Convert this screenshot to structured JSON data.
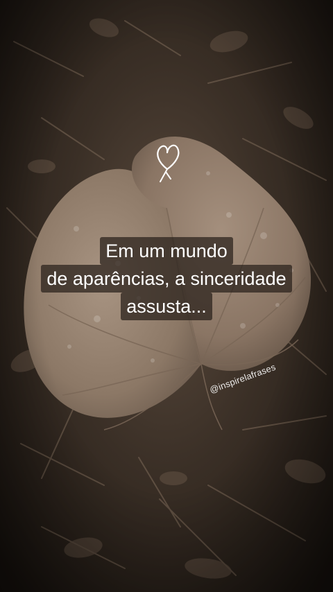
{
  "quote": {
    "line1": "Em um mundo",
    "line2": "de aparências, a sinceridade",
    "line3": "assusta..."
  },
  "handle": "@inspirelafrases",
  "icons": {
    "heart": "heart-outline-icon"
  },
  "colors": {
    "text": "#ffffff",
    "text_highlight": "#28201a",
    "leaf": "#9a8674",
    "ground": "#3a2f26"
  }
}
